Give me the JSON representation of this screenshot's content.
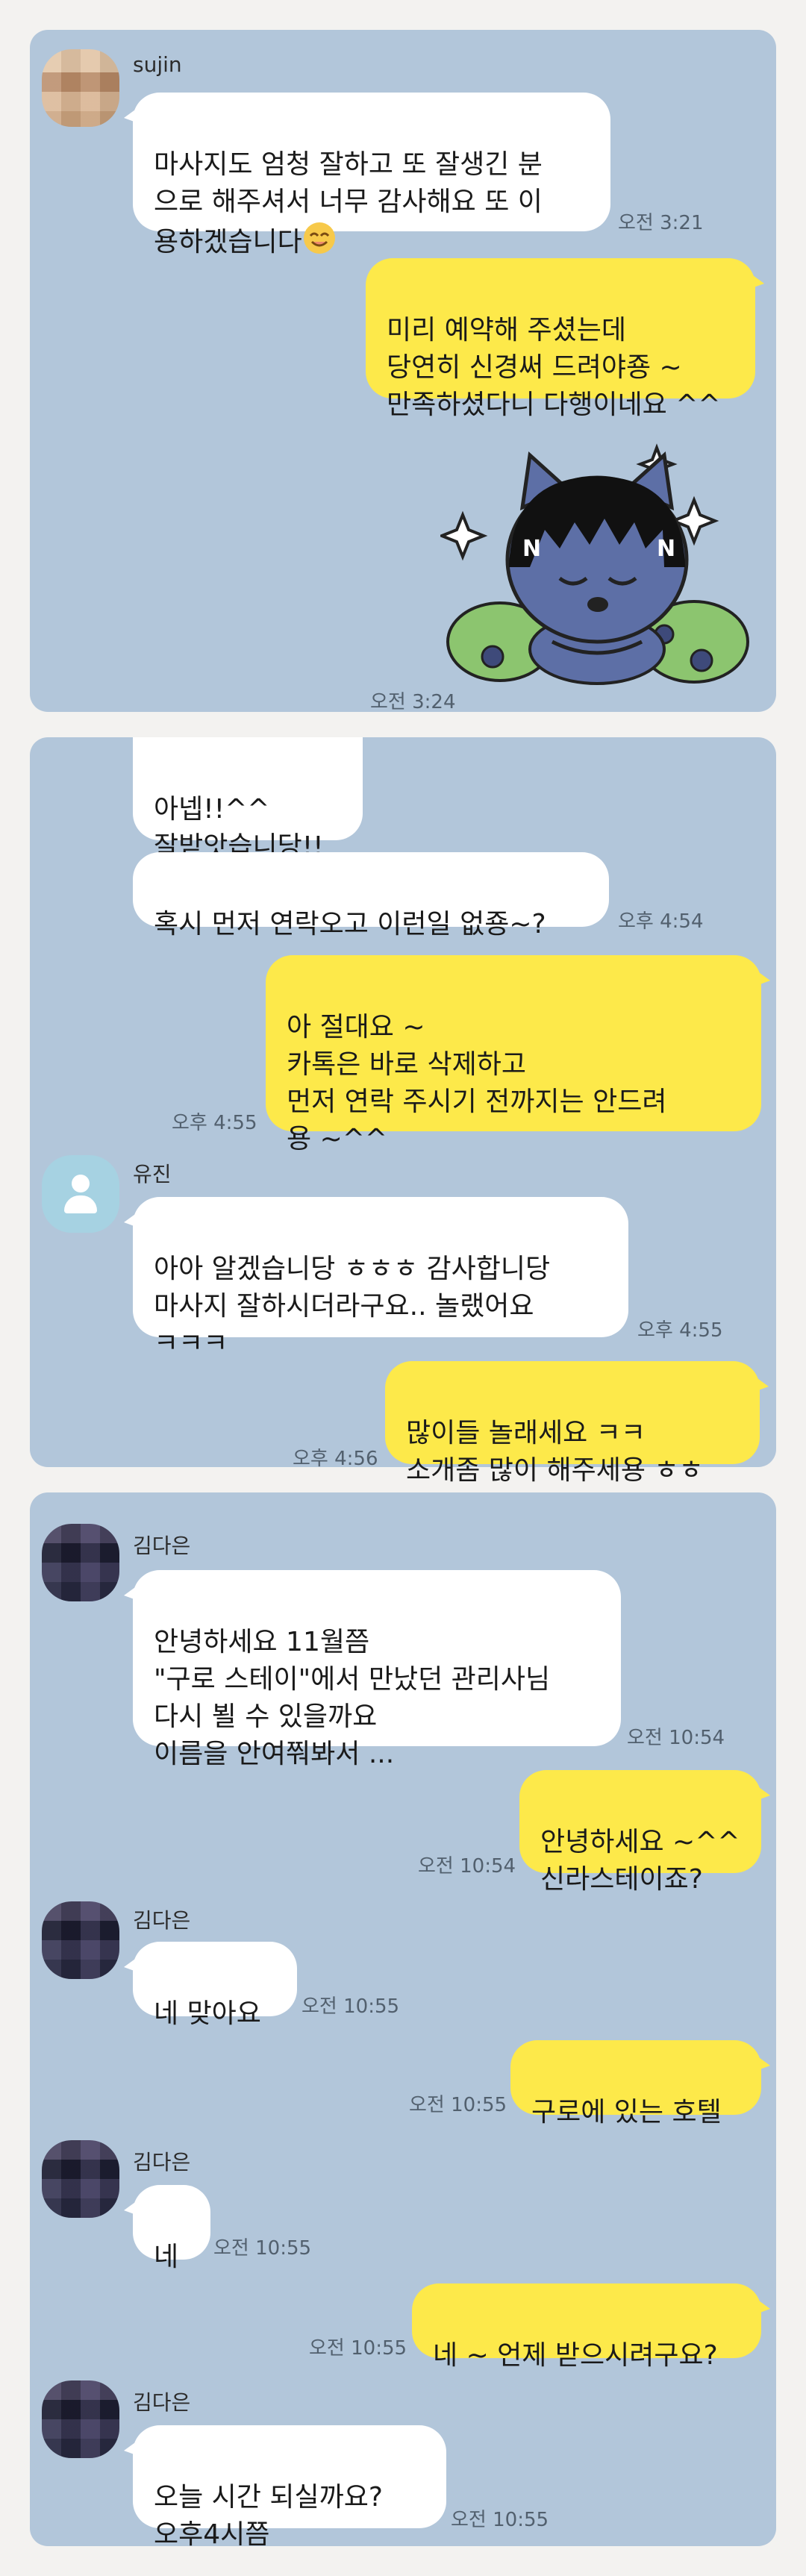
{
  "panel1": {
    "sender": "sujin",
    "msg1_text": "마사지도 엄청 잘하고 또 잘생긴 분\n으로 해주셔서 너무 감사해요 또 이\n용하겠습니다",
    "msg1_time": "오전 3:21",
    "reply_text": "미리 예약해 주셨는데\n당연히 신경써 드려야죵 ~\n만족하셨다니 다행이네요 ^^",
    "sticker_time": "오전 3:24",
    "sticker_badge_left": "N",
    "sticker_badge_right": "N"
  },
  "panel2": {
    "msg1_text": "아넵!!^^\n잘받앗습니당!!",
    "msg2_text": "혹시 먼저 연락오고 이런일 없죵~?",
    "msg2_time": "오후 4:54",
    "reply1_text": "아 절대요 ~\n카톡은 바로 삭제하고\n먼저 연락 주시기 전까지는 안드려\n용 ~^^",
    "reply1_time": "오후 4:55",
    "sender": "유진",
    "msg3_text": "아아 알겠습니당 ㅎㅎㅎ 감사합니당\n마사지 잘하시더라구요.. 놀랬어요\nㅋㅋㅋ",
    "msg3_time": "오후 4:55",
    "reply2_text": "많이들 놀래세요 ㅋㅋ\n소개좀 많이 해주세용 ㅎㅎ",
    "reply2_time": "오후 4:56"
  },
  "panel3": {
    "sender": "김다은",
    "msg1_text": "안녕하세요 11월쯤\n\"구로 스테이\"에서 만났던 관리사님\n다시 뵐 수 있을까요\n이름을 안여쭤봐서 ...",
    "msg1_time": "오전 10:54",
    "reply1_text": "안녕하세요 ~^^\n신라스테이죠?",
    "reply1_time": "오전 10:54",
    "sender2": "김다은",
    "msg2_text": "네 맞아요",
    "msg2_time": "오전 10:55",
    "reply2_text": "구로에 있는 호텔",
    "reply2_time": "오전 10:55",
    "sender3": "김다은",
    "msg3_text": "네",
    "msg3_time": "오전 10:55",
    "reply3_text": "네 ~ 언제 받으시려구요?",
    "reply3_time": "오전 10:55",
    "sender4": "김다은",
    "msg4_text": "오늘  시간 되실까요?\n오후4시쯤",
    "msg4_time": "오전 10:55"
  },
  "colors": {
    "chat_bg": "#b2c6da",
    "incoming": "#ffffff",
    "outgoing": "#fde94a",
    "page_bg": "#f3f2f0"
  },
  "icons": {
    "smile_emoji": "smiling-face-icon",
    "sticker": "kakao-character-sticker",
    "default_avatar": "person-silhouette-icon"
  }
}
